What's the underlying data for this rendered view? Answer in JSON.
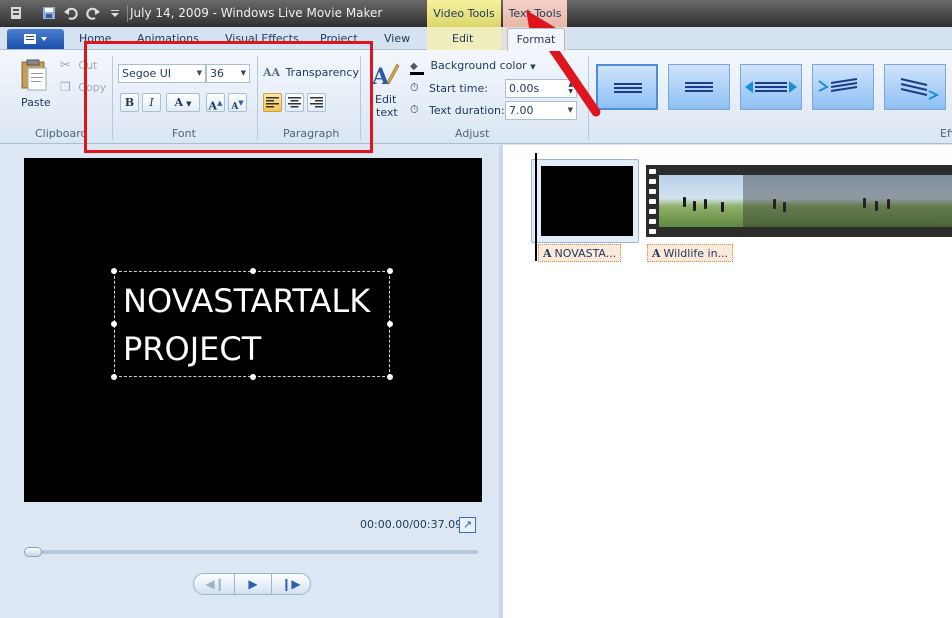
{
  "titlebar": {
    "title": "July 14, 2009 - Windows Live Movie Maker",
    "context_video": "Video Tools",
    "context_text": "Text Tools"
  },
  "tabs": {
    "home": "Home",
    "animations": "Animations",
    "visual_effects": "Visual Effects",
    "project": "Project",
    "view": "View",
    "edit": "Edit",
    "format": "Format"
  },
  "ribbon": {
    "clipboard": {
      "paste": "Paste",
      "cut": "Cut",
      "copy": "Copy",
      "label": "Clipboard"
    },
    "font": {
      "family": "Segoe UI",
      "size": "36",
      "bold": "B",
      "italic": "I",
      "color": "A",
      "grow": "A",
      "shrink": "A",
      "label": "Font"
    },
    "paragraph": {
      "transparency": "Transparency",
      "label": "Paragraph"
    },
    "adjust": {
      "edit_text_line1": "Edit",
      "edit_text_line2": "text",
      "background_color": "Background color",
      "start_time_label": "Start time:",
      "start_time_value": "0.00s",
      "text_duration_label": "Text duration:",
      "text_duration_value": "7.00",
      "label": "Adjust"
    },
    "effects": {
      "label": "Eff"
    }
  },
  "preview": {
    "caption_line1": "NOVASTARTALK",
    "caption_line2": "PROJECT",
    "timecode": "00:00.00/00:37.09"
  },
  "storyboard": {
    "caption1": "NOVASTA...",
    "caption2": "Wildlife in..."
  },
  "colors": {
    "annotation_red": "#e0141c",
    "video_tools": "#f0eba0",
    "text_tools": "#f1cfc4"
  }
}
